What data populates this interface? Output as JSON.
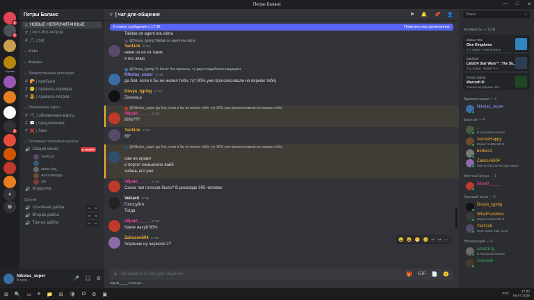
{
  "window": {
    "title": "Петры Баланс",
    "controls": [
      "—",
      "□",
      "✕"
    ]
  },
  "guilds": [
    {
      "label": "",
      "color": "#e04555",
      "badge": "1"
    },
    {
      "label": "",
      "color": "#4e5058",
      "badge": "1"
    },
    {
      "label": "",
      "color": "#c9a050",
      "badge": ""
    },
    {
      "label": "",
      "color": "#b8860b",
      "badge": "",
      "caption": "Сервак"
    },
    {
      "label": "",
      "color": "#9b59b6",
      "badge": ""
    },
    {
      "label": "",
      "color": "#e67e22",
      "badge": ""
    },
    {
      "label": "",
      "color": "#ffffff",
      "badge": ""
    },
    {
      "label": "",
      "color": "#2f3136",
      "badge": "1"
    },
    {
      "label": "",
      "color": "#e74c3c",
      "badge": ""
    },
    {
      "label": "",
      "color": "#d35400",
      "badge": ""
    },
    {
      "label": "",
      "color": "#c0392b",
      "badge": ""
    },
    {
      "label": "",
      "color": "#e67e22",
      "badge": ""
    },
    {
      "label": "+",
      "color": "#313338",
      "badge": ""
    },
    {
      "label": "⊙",
      "color": "#313338",
      "badge": ""
    }
  ],
  "sidebar": {
    "server_name": "Петры Баланс",
    "top_items": [
      {
        "icon": "#",
        "label": "НОВЫЕ НЕПРОЧИТАННЫЕ",
        "selected": true
      },
      {
        "icon": "#",
        "label": "| хост-бот-петров"
      },
      {
        "icon": "#",
        "label": "🎵 | bot"
      }
    ],
    "categories": [
      {
        "title": "Инфо",
        "items": []
      },
      {
        "title": "Форумы",
        "items": []
      },
      {
        "title": "Приветственная категория",
        "items": [
          {
            "icon": "#",
            "label": "🥐 | прибыхи"
          },
          {
            "icon": "#",
            "label": "🙂 | правила-сервера"
          },
          {
            "icon": "#",
            "label": "😎 | правила-петров"
          }
        ]
      },
      {
        "title": "Обновление карты",
        "items": [
          {
            "icon": "#",
            "label": "⛏ | обновление-карты"
          },
          {
            "icon": "#",
            "label": "💬 | предложения"
          },
          {
            "icon": "#",
            "label": "❌ | баги"
          }
        ]
      },
      {
        "title": "Основные голосовые каналы",
        "items": []
      }
    ],
    "voice_channel": {
      "label": "Общий канал",
      "live": "В ЭФИРЕ"
    },
    "voice_users": [
      "Yar41ck",
      "",
      "amaz1ng_",
      "AuroraHappy",
      "nift"
    ],
    "floodilka": "Флудилка",
    "voice_category2": "Эрполи",
    "voice_channels2": [
      {
        "label": "Основная дабла",
        "a": "00",
        "b": "00"
      },
      {
        "label": "Вторая дабла",
        "a": "00",
        "b": "00"
      },
      {
        "label": "Третья дабла",
        "a": "00",
        "b": "00"
      }
    ]
  },
  "user_panel": {
    "name": "Nikolas_super",
    "status": "В сети",
    "icons": [
      "🎤",
      "🎧",
      "⚙"
    ]
  },
  "header": {
    "channel": "| чат-для-общения",
    "icons": [
      "⚑",
      "🔔",
      "📌",
      "👤"
    ]
  },
  "new_bar": {
    "text": "6 новых сообщения с 17:30",
    "action": "Пометить как прочитанное"
  },
  "messages": [
    {
      "kind": "cont",
      "text": "Takitak on agent eta vidna"
    },
    {
      "kind": "reply_full",
      "reply": "@Dosya_typing Takitak on agent eta vidna",
      "name": "Yar41ck",
      "name_color": "#f0b232",
      "time": "17:22",
      "avatar_color": "#5a4a6a",
      "lines": [
        "неме он не из таких",
        "я его знаю"
      ]
    },
    {
      "kind": "reply_full",
      "reply": "@Dosya_typing То банят без причины, ту двух пиздаболов защищает",
      "name": "Nikolas_super",
      "name_color": "#949cf7",
      "time": "17:22",
      "avatar_color": "#3a6ea5",
      "lines": [
        "да бля, если я бы не желил тебя, тут 90% уже проголосовали на пермак тебе)"
      ]
    },
    {
      "kind": "full",
      "name": "Dosya_typing",
      "name_color": "#f0b232",
      "time": "17:23",
      "avatar_color": "#111111",
      "lines": [
        "Zaxaxa,a"
      ]
    },
    {
      "kind": "reply_full",
      "reply": "@Nikolas_super да бля, если я бы не желил тебя, тут 90% уже проголосовали на пермак тебе)",
      "name": "iMpakt_____",
      "name_color": "#eb459e",
      "time": "17:23",
      "avatar_color": "#c0392b",
      "lines": [
        "90%???"
      ],
      "highlight": true
    },
    {
      "kind": "full",
      "name": "Yar41ck",
      "name_color": "#f0b232",
      "time": "17:23",
      "avatar_color": "#5a4a6a",
      "lines": [
        "89*"
      ]
    },
    {
      "kind": "reply_full",
      "reply": "@Nikolas_super да бля, если я бы не желил тебя, тут 90% уже проголосовали на пермак тебе)",
      "name": "",
      "name_color": "#f0b232",
      "time": "",
      "avatar_color": "#2f4f6f",
      "lines": [
        "сам не играет",
        "и портит комьюнити вайб",
        "забань его уже"
      ],
      "highlight": true
    },
    {
      "kind": "full",
      "name": "iMpakt_____",
      "name_color": "#eb459e",
      "time": "17:25",
      "avatar_color": "#c0392b",
      "lines": [
        "Скока там голосов было? В дискорде 395 человек"
      ]
    },
    {
      "kind": "full",
      "name": "Velzard",
      "name_color": "#f2f3f5",
      "time": "17:25",
      "avatar_color": "#222222",
      "lines": [
        "Голосуйте",
        "Тогда"
      ]
    },
    {
      "kind": "full",
      "name": "iMpakt_____",
      "name_color": "#eb459e",
      "time": "17:25",
      "avatar_color": "#c0392b",
      "lines": [
        "Какие нахуй 90%"
      ]
    },
    {
      "kind": "full",
      "name": "Zakuson504",
      "name_color": "#f0b232",
      "time": "17:26",
      "avatar_color": "#8e6aa8",
      "lines": [
        "Хорошие ну неужели 2?"
      ]
    }
  ],
  "composer": {
    "placeholder": "Написать в # | чат-для-общения",
    "plus": "+",
    "icons": [
      "🎁",
      "GIF",
      "📄",
      "🙂"
    ]
  },
  "typing": "iMpakt_____ печатает...",
  "message_actions": [
    "😄",
    "😆",
    "😁",
    "😐",
    "↩",
    "↪",
    "⋯"
  ],
  "members": {
    "search_placeholder": "Поиск",
    "activity_title": "Активность — 13 ✿",
    "activities": [
      {
        "line1": "drakee-001",
        "line2": "Dice Kingdoms",
        "line3": "2 ч. назад · Новый игрок",
        "color": "#2e86c1"
      },
      {
        "line1": "Madcroil",
        "line2": "LEGO® Star Wars™: The Sk...",
        "line3": "2 д. назад · Играет 6 ч",
        "color": "#2c3e50"
      },
      {
        "line1": "Dosya_typing",
        "line2": "Warcraft III",
        "line3": "Самая популярная: 48 ч",
        "color": "#1e4620"
      }
    ],
    "groups": [
      {
        "title": "Администрация — 1",
        "members": [
          {
            "name": "Nikolas_super",
            "color": "#949cf7",
            "sub": "",
            "avatar": "#3a6ea5"
          }
        ]
      },
      {
        "title": "Блатной — 4",
        "members": [
          {
            "name": "...",
            "color": "#f0b232",
            "sub": "В голосовом канале",
            "avatar": "#4a5a3a"
          },
          {
            "name": "AuroraHappy",
            "color": "#f0b232",
            "sub": "Играет в Warcraft III",
            "avatar": "#6a4a2a"
          },
          {
            "name": "borbos1",
            "color": "#f0b232",
            "sub": "",
            "avatar": "#7a7a7a"
          },
          {
            "name": "Zakuson504",
            "color": "#f0b232",
            "sub": "Мне по носу на на игру, какую",
            "avatar": "#8e6aa8"
          }
        ]
      },
      {
        "title": "Местный Клоун — 1",
        "members": [
          {
            "name": "iMpakt_____",
            "color": "#eb459e",
            "sub": "",
            "avatar": "#c0392b"
          }
        ]
      },
      {
        "title": "Хороший игрок — 3",
        "members": [
          {
            "name": "Dosya_typing",
            "color": "#f0b232",
            "sub": "",
            "avatar": "#111111"
          },
          {
            "name": "WhatFuckMen",
            "color": "#f0b232",
            "sub": "Играет в Warcraft III",
            "avatar": "#3a3a3a"
          },
          {
            "name": "Yar41ck",
            "color": "#f0b232",
            "sub": "Игра может ещё, если",
            "avatar": "#5a4a6a"
          }
        ]
      },
      {
        "title": "Начинающий — 9",
        "members": [
          {
            "name": "amaz1ng_",
            "color": "#3ba55c",
            "sub": "В голосовом канале",
            "avatar": "#6a6a6a"
          },
          {
            "name": "Amiracle",
            "color": "#3ba55c",
            "sub": "",
            "avatar": "#4a3a2a"
          }
        ]
      }
    ]
  },
  "taskbar": {
    "apps": [
      "⊞",
      "🔍",
      "▭",
      "e",
      "📁",
      "⊞",
      "🛡",
      "O",
      "⚙",
      "▣"
    ],
    "lang": "РУС",
    "time": "17:32",
    "date": "04.07.2025"
  }
}
